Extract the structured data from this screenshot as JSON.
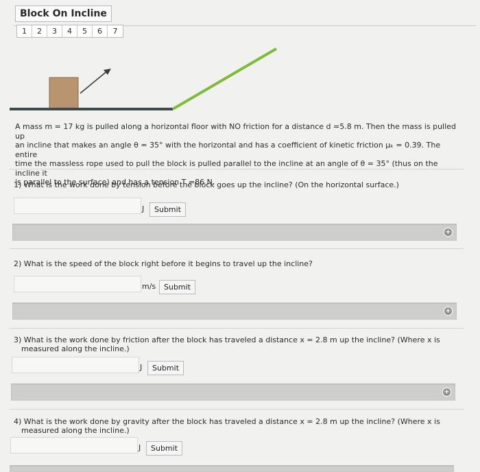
{
  "title": "Block On Incline",
  "tabs": [
    "1",
    "2",
    "3",
    "4",
    "5",
    "6",
    "7"
  ],
  "problem": [
    "A mass m = 17 kg is pulled along a horizontal floor with NO friction for a distance d =5.8 m. Then the mass is pulled up",
    "an incline that makes an angle θ = 35° with the horizontal and has a coefficient of kinetic friction μₖ = 0.39. The entire",
    "time the massless rope used to pull the block is pulled parallel to the incline at an angle of θ = 35° (thus on the incline it",
    "is parallel to the surface) and has a tension T =86 N."
  ],
  "questions": [
    {
      "text": [
        "1) What is the work done by tension before the block goes up the incline? (On the horizontal surface.)"
      ],
      "unit": "J",
      "submit": "Submit"
    },
    {
      "text": [
        "2) What is the speed of the block right before it begins to travel up the incline?"
      ],
      "unit": "m/s",
      "submit": "Submit"
    },
    {
      "text": [
        "3) What is the work done by friction after the block has traveled a distance x = 2.8 m up the incline? (Where x is",
        "measured along the incline.)"
      ],
      "unit": "J",
      "submit": "Submit"
    },
    {
      "text": [
        "4) What is the work done by gravity after the block has traveled a distance x = 2.8 m up the incline? (Where x is",
        "measured along the incline.)"
      ],
      "unit": "J",
      "submit": "Submit"
    }
  ],
  "colors": {
    "block": "#b8956f",
    "incline": "#7fba3a",
    "floor": "#3d4a4f",
    "hint_bar": "#cececc"
  }
}
